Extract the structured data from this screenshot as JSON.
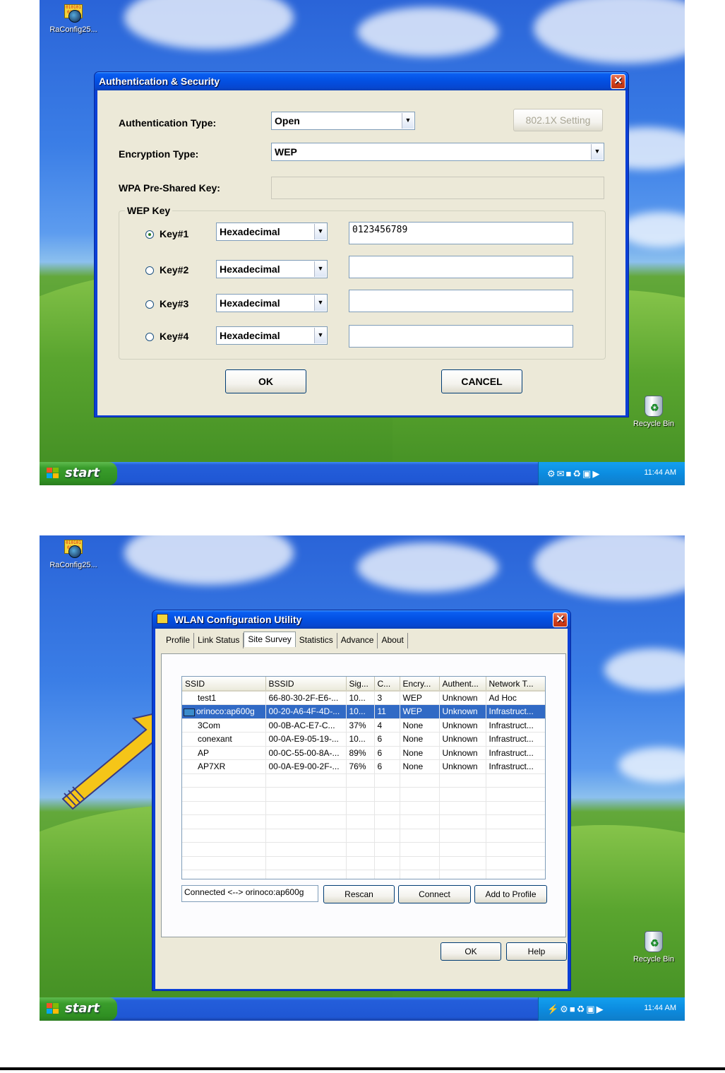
{
  "desktop": {
    "icon_label": "RaConfig25...",
    "recycle_label": "Recycle Bin",
    "start_label": "start",
    "clock": "11:44 AM"
  },
  "auth_dialog": {
    "title": "Authentication & Security",
    "auth_type_label": "Authentication Type:",
    "auth_type_value": "Open",
    "btn_8021x": "802.1X Setting",
    "enc_type_label": "Encryption Type:",
    "enc_type_value": "WEP",
    "wpa_psk_label": "WPA Pre-Shared Key:",
    "wpa_psk_value": "",
    "wep_group_label": "WEP Key",
    "keys": [
      {
        "label": "Key#1",
        "format": "Hexadecimal",
        "value": "0123456789",
        "selected": true
      },
      {
        "label": "Key#2",
        "format": "Hexadecimal",
        "value": "",
        "selected": false
      },
      {
        "label": "Key#3",
        "format": "Hexadecimal",
        "value": "",
        "selected": false
      },
      {
        "label": "Key#4",
        "format": "Hexadecimal",
        "value": "",
        "selected": false
      }
    ],
    "ok": "OK",
    "cancel": "CANCEL"
  },
  "wlan_dialog": {
    "title": "WLAN Configuration Utility",
    "tabs": [
      "Profile",
      "Link Status",
      "Site Survey",
      "Statistics",
      "Advance",
      "About"
    ],
    "active_tab": "Site Survey",
    "columns": [
      "SSID",
      "BSSID",
      "Sig...",
      "C...",
      "Encry...",
      "Authent...",
      "Network T..."
    ],
    "rows": [
      [
        "test1",
        "66-80-30-2F-E6-...",
        "10...",
        "3",
        "WEP",
        "Unknown",
        "Ad Hoc"
      ],
      [
        "orinoco:ap600g",
        "00-20-A6-4F-4D-...",
        "10...",
        "11",
        "WEP",
        "Unknown",
        "Infrastruct..."
      ],
      [
        "3Com",
        "00-0B-AC-E7-C...",
        "37%",
        "4",
        "None",
        "Unknown",
        "Infrastruct..."
      ],
      [
        "conexant",
        "00-0A-E9-05-19-...",
        "10...",
        "6",
        "None",
        "Unknown",
        "Infrastruct..."
      ],
      [
        "AP",
        "00-0C-55-00-8A-...",
        "89%",
        "6",
        "None",
        "Unknown",
        "Infrastruct..."
      ],
      [
        "AP7XR",
        "00-0A-E9-00-2F-...",
        "76%",
        "6",
        "None",
        "Unknown",
        "Infrastruct..."
      ]
    ],
    "selected_row": 1,
    "status_text": "Connected <--> orinoco:ap600g",
    "rescan": "Rescan",
    "connect": "Connect",
    "add_to_profile": "Add to Profile",
    "ok": "OK",
    "help": "Help"
  },
  "colors": {
    "selection": "#316ac5",
    "arrow": "#f5c518"
  }
}
